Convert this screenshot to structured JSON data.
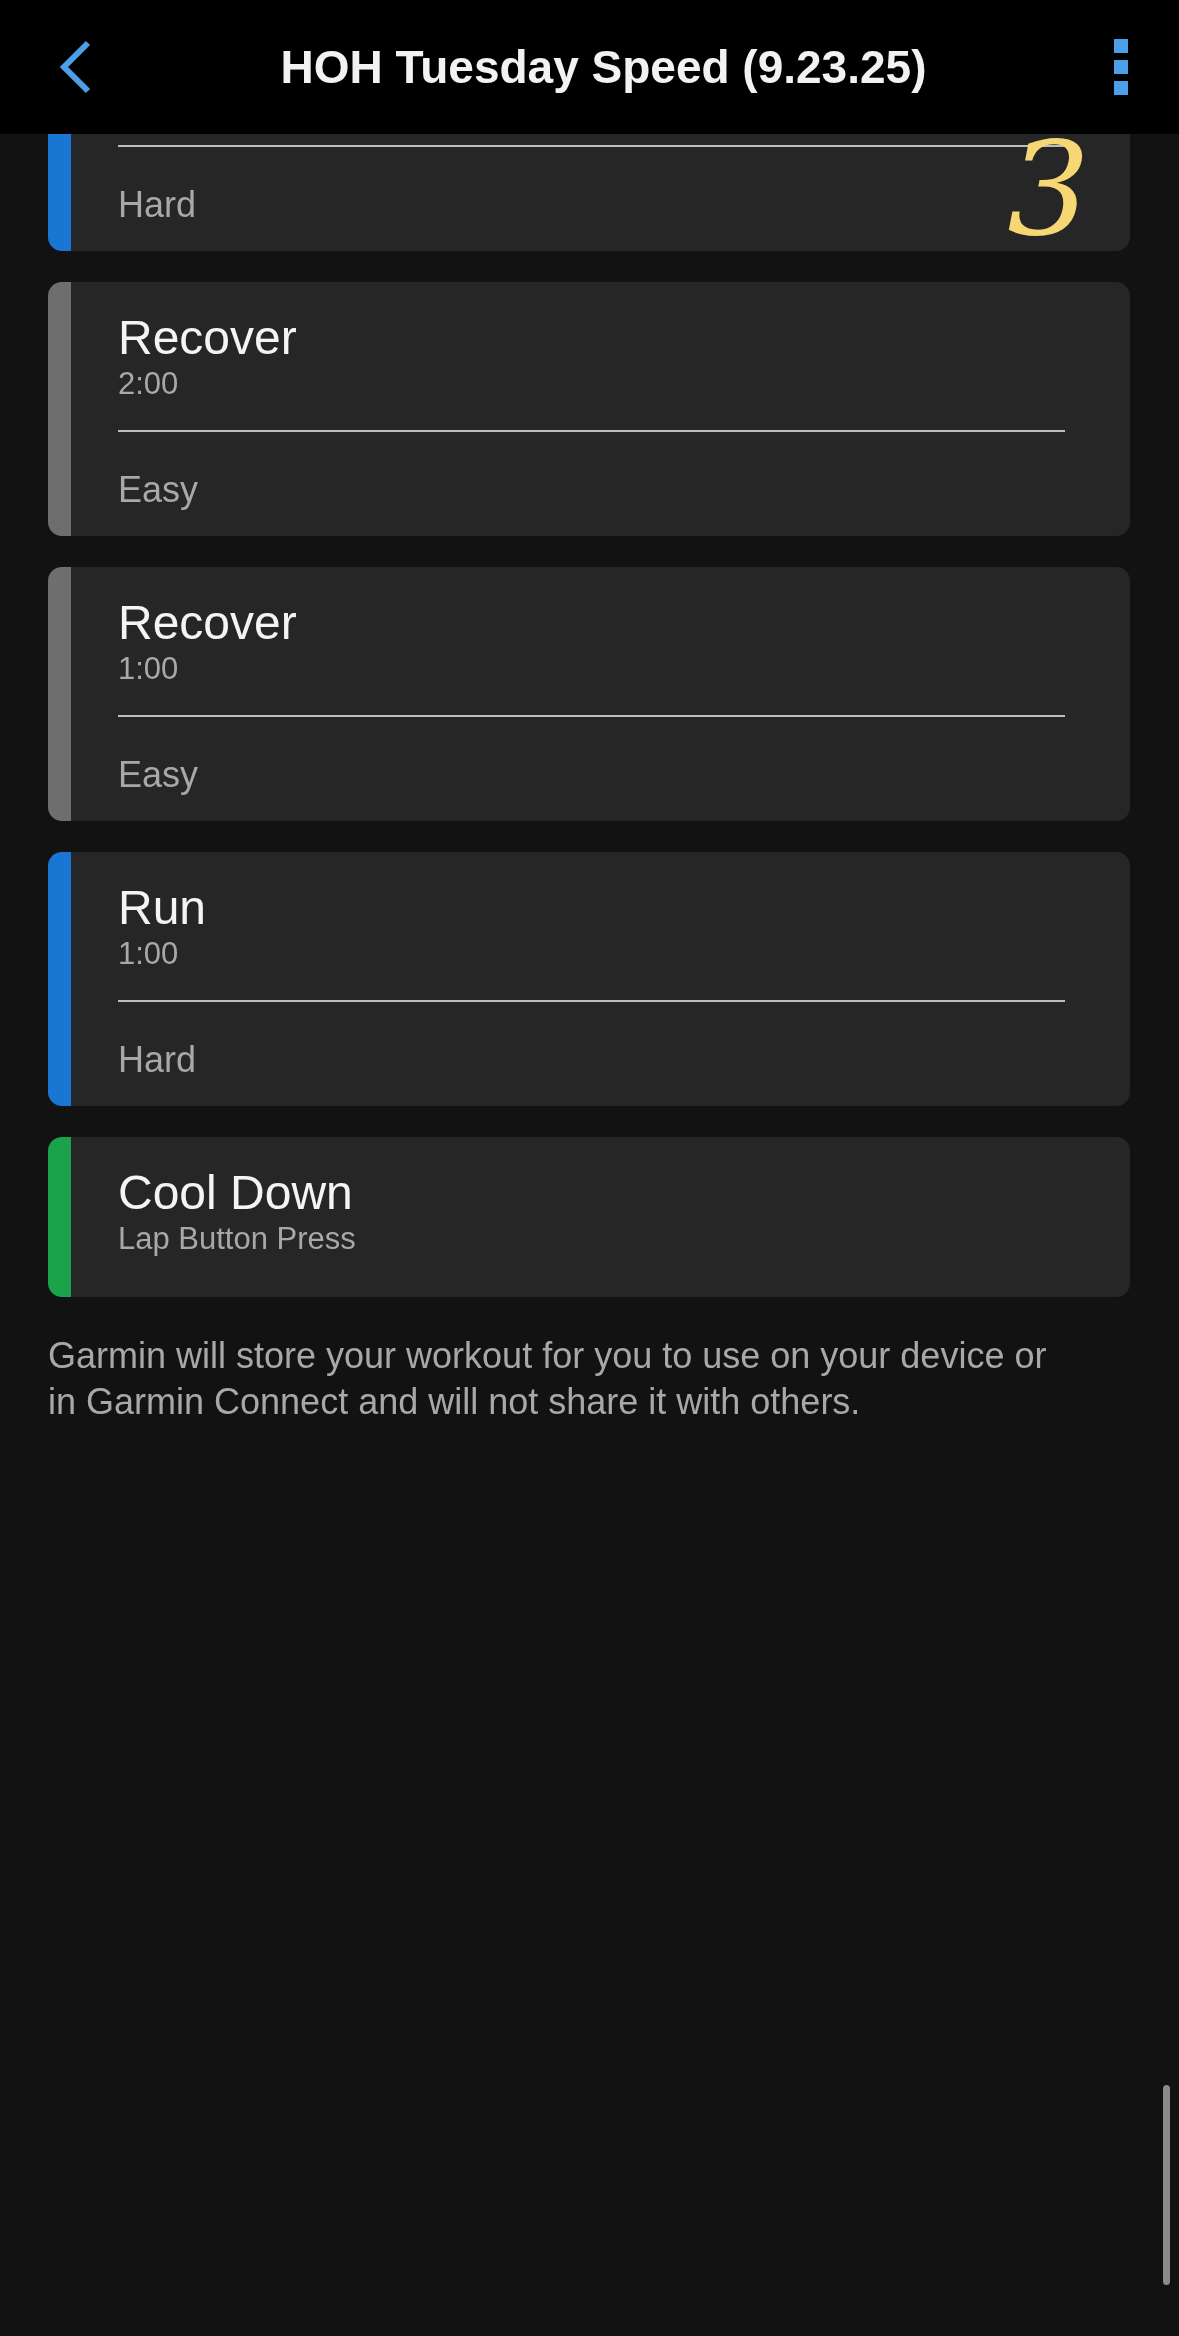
{
  "header": {
    "title": "HOH Tuesday Speed (9.23.25)"
  },
  "steps": [
    {
      "intensity": "Hard",
      "color": "#1976d2"
    },
    {
      "title": "Recover",
      "duration": "2:00",
      "intensity": "Easy",
      "color": "#6e6e6e"
    },
    {
      "title": "Recover",
      "duration": "1:00",
      "intensity": "Easy",
      "color": "#6e6e6e"
    },
    {
      "title": "Run",
      "duration": "1:00",
      "intensity": "Hard",
      "color": "#1976d2"
    },
    {
      "title": "Cool Down",
      "duration": "Lap Button Press",
      "color": "#1aa34a"
    }
  ],
  "annotation": "3",
  "footer": "Garmin will store your workout for you to use on your device or in Garmin Connect and will not share it with others."
}
